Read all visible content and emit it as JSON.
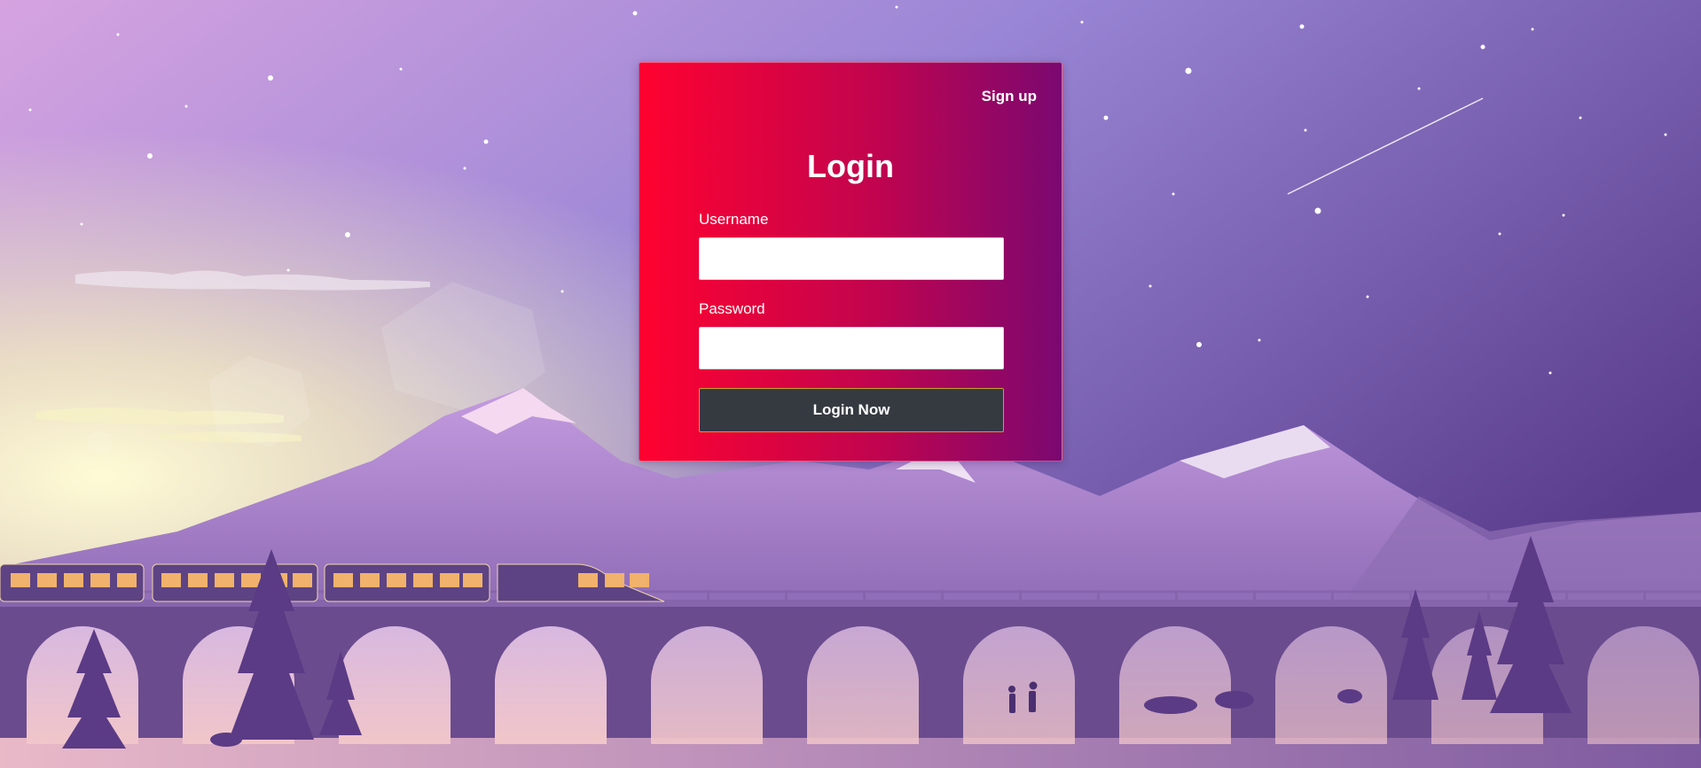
{
  "login_card": {
    "signup_link": "Sign up",
    "title": "Login",
    "username": {
      "label": "Username",
      "value": "",
      "placeholder": ""
    },
    "password": {
      "label": "Password",
      "value": "",
      "placeholder": ""
    },
    "submit_label": "Login Now"
  },
  "background": {
    "description_icon": "mountain-railway-dusk-illustration",
    "sky_top": "#c79ad9",
    "sky_right": "#5c3d8e",
    "sun_glow": "#fff6c8",
    "mountain_color": "#a27cc0",
    "bridge_color": "#6a4b8e",
    "card_gradient_start": "#ff0230",
    "card_gradient_end": "#7b0870",
    "button_color": "#343a40"
  }
}
